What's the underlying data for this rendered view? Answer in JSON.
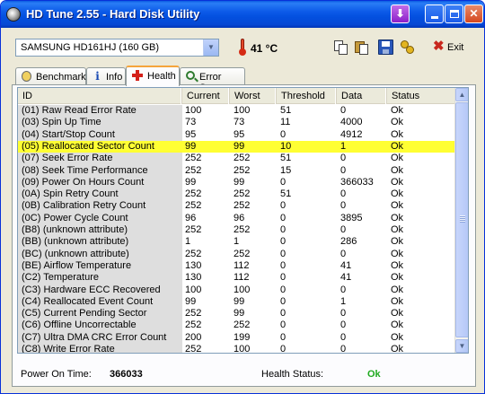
{
  "window": {
    "title": "HD Tune 2.55 - Hard Disk Utility"
  },
  "toolbar": {
    "drive": "SAMSUNG HD161HJ (160 GB)",
    "temperature": "41 °C",
    "exit_label": "Exit"
  },
  "tabs": [
    {
      "label": "Benchmark",
      "icon": "benchmark-icon"
    },
    {
      "label": "Info",
      "icon": "info-icon"
    },
    {
      "label": "Health",
      "icon": "health-cross-icon",
      "active": true
    },
    {
      "label": "Error Scan",
      "icon": "error-scan-icon"
    }
  ],
  "table": {
    "headers": [
      "ID",
      "Current",
      "Worst",
      "Threshold",
      "Data",
      "Status"
    ],
    "highlight_color": "#ffff33",
    "rows": [
      [
        "(01) Raw Read Error Rate",
        "100",
        "100",
        "51",
        "0",
        "Ok"
      ],
      [
        "(03) Spin Up Time",
        "73",
        "73",
        "11",
        "4000",
        "Ok"
      ],
      [
        "(04) Start/Stop Count",
        "95",
        "95",
        "0",
        "4912",
        "Ok"
      ],
      [
        "(05) Reallocated Sector Count",
        "99",
        "99",
        "10",
        "1",
        "Ok"
      ],
      [
        "(07) Seek Error Rate",
        "252",
        "252",
        "51",
        "0",
        "Ok"
      ],
      [
        "(08) Seek Time Performance",
        "252",
        "252",
        "15",
        "0",
        "Ok"
      ],
      [
        "(09) Power On Hours Count",
        "99",
        "99",
        "0",
        "366033",
        "Ok"
      ],
      [
        "(0A) Spin Retry Count",
        "252",
        "252",
        "51",
        "0",
        "Ok"
      ],
      [
        "(0B) Calibration Retry Count",
        "252",
        "252",
        "0",
        "0",
        "Ok"
      ],
      [
        "(0C) Power Cycle Count",
        "96",
        "96",
        "0",
        "3895",
        "Ok"
      ],
      [
        "(B8) (unknown attribute)",
        "252",
        "252",
        "0",
        "0",
        "Ok"
      ],
      [
        "(BB) (unknown attribute)",
        "1",
        "1",
        "0",
        "286",
        "Ok"
      ],
      [
        "(BC) (unknown attribute)",
        "252",
        "252",
        "0",
        "0",
        "Ok"
      ],
      [
        "(BE) Airflow Temperature",
        "130",
        "112",
        "0",
        "41",
        "Ok"
      ],
      [
        "(C2) Temperature",
        "130",
        "112",
        "0",
        "41",
        "Ok"
      ],
      [
        "(C3) Hardware ECC Recovered",
        "100",
        "100",
        "0",
        "0",
        "Ok"
      ],
      [
        "(C4) Reallocated Event Count",
        "99",
        "99",
        "0",
        "1",
        "Ok"
      ],
      [
        "(C5) Current Pending Sector",
        "252",
        "99",
        "0",
        "0",
        "Ok"
      ],
      [
        "(C6) Offline Uncorrectable",
        "252",
        "252",
        "0",
        "0",
        "Ok"
      ],
      [
        "(C7) Ultra DMA CRC Error Count",
        "200",
        "199",
        "0",
        "0",
        "Ok"
      ],
      [
        "(C8) Write Error Rate",
        "252",
        "100",
        "0",
        "0",
        "Ok"
      ]
    ],
    "highlighted_row": 3
  },
  "footer": {
    "power_on_label": "Power On Time:",
    "power_on_value": "366033",
    "health_label": "Health Status:",
    "health_value": "Ok",
    "health_color": "#1faa1f"
  }
}
